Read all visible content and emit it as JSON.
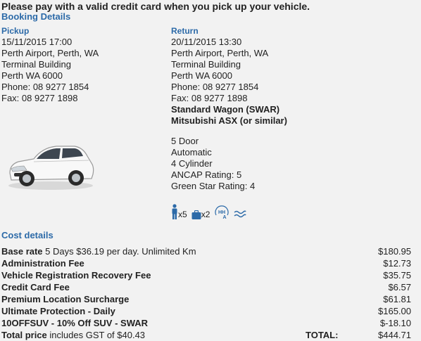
{
  "notice": "Please pay with a valid credit card when you pick up your vehicle.",
  "booking_title": "Booking Details",
  "pickup": {
    "heading": "Pickup",
    "lines": [
      "15/11/2015 17:00",
      "Perth Airport, Perth, WA",
      "Terminal Building",
      "Perth WA 6000",
      "Phone: 08 9277 1854",
      "Fax: 08 9277 1898"
    ]
  },
  "return": {
    "heading": "Return",
    "lines": [
      "20/11/2015 13:30",
      "Perth Airport, Perth, WA",
      "Terminal Building",
      "Perth WA 6000",
      "Phone: 08 9277 1854",
      "Fax: 08 9277 1898"
    ]
  },
  "vehicle": {
    "category": "Standard Wagon (SWAR)",
    "model": "Mitsubishi ASX (or similar)",
    "specs": [
      "5 Door",
      "Automatic",
      "4 Cylinder",
      "ANCAP Rating: 5",
      "Green Star Rating: 4"
    ],
    "features": {
      "passengers_icon": "person-icon",
      "passengers": "x5",
      "luggage_icon": "suitcase-icon",
      "luggage": "x2",
      "hill_hold_icon": "hill-hold-assist-icon",
      "climate_icon": "air-conditioning-icon"
    }
  },
  "cost": {
    "title": "Cost details",
    "base": {
      "label": "Base rate",
      "detail": "5 Days $36.19 per day. Unlimited Km",
      "amount": "$180.95"
    },
    "items": [
      {
        "label": "Administration Fee",
        "amount": "$12.73"
      },
      {
        "label": "Vehicle Registration Recovery Fee",
        "amount": "$35.75"
      },
      {
        "label": "Credit Card Fee",
        "amount": "$6.57"
      },
      {
        "label": "Premium Location Surcharge",
        "amount": "$61.81"
      },
      {
        "label": "Ultimate Protection - Daily",
        "amount": "$165.00"
      },
      {
        "label": "10OFFSUV - 10% Off SUV - SWAR",
        "amount": "$-18.10"
      }
    ],
    "total": {
      "label": "Total price",
      "detail": "includes GST of $40.43",
      "total_label": "TOTAL:",
      "amount": "$444.71"
    }
  },
  "colors": {
    "accent": "#2c6aa8",
    "background": "#f2f2f2",
    "text": "#222222"
  }
}
